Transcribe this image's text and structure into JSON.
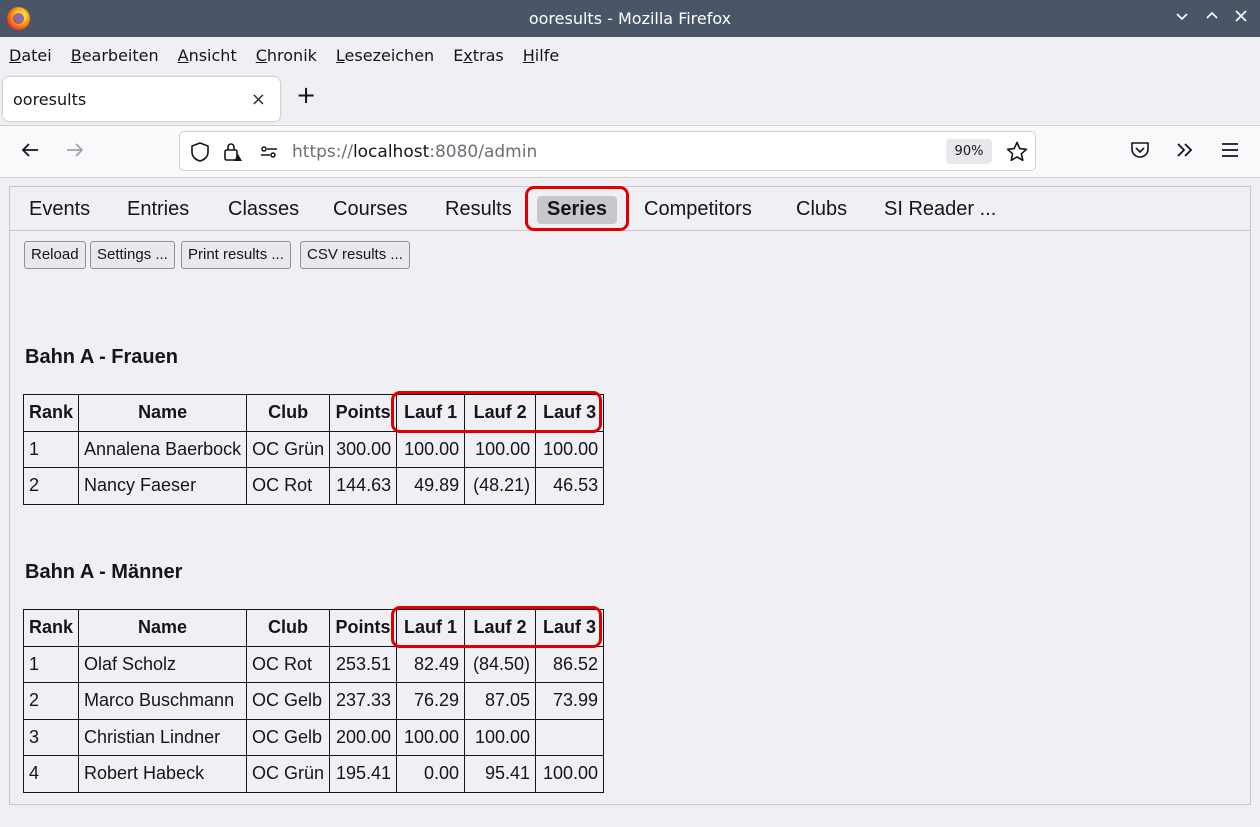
{
  "window": {
    "title": "ooresults - Mozilla Firefox"
  },
  "menu": {
    "items": [
      {
        "acc": "D",
        "rest": "atei"
      },
      {
        "acc": "B",
        "rest": "earbeiten"
      },
      {
        "acc": "A",
        "rest": "nsicht"
      },
      {
        "acc": "C",
        "rest": "hronik"
      },
      {
        "acc": "L",
        "rest": "esezeichen"
      },
      {
        "pre": "E",
        "acc": "x",
        "rest": "tras"
      },
      {
        "acc": "H",
        "rest": "ilfe"
      }
    ]
  },
  "browser_tab": {
    "label": "ooresults",
    "close": "×"
  },
  "new_tab": "+",
  "urlbar": {
    "scheme": "https://",
    "host": "localhost",
    "rest": ":8080/admin",
    "zoom": "90%"
  },
  "app_tabs": [
    "Events",
    "Entries",
    "Classes",
    "Courses",
    "Results",
    "Series",
    "Competitors",
    "Clubs",
    "SI Reader ..."
  ],
  "active_tab": "Series",
  "buttons": {
    "reload": "Reload",
    "settings": "Settings ...",
    "print": "Print results ...",
    "csv": "CSV results ..."
  },
  "columns": [
    "Rank",
    "Name",
    "Club",
    "Points",
    "Lauf 1",
    "Lauf 2",
    "Lauf 3"
  ],
  "sections": [
    {
      "title": "Bahn A - Frauen",
      "rows": [
        [
          "1",
          "Annalena Baerbock",
          "OC Grün",
          "300.00",
          "100.00",
          "100.00",
          "100.00"
        ],
        [
          "2",
          "Nancy Faeser",
          "OC Rot",
          "144.63",
          "49.89",
          "(48.21)",
          "46.53"
        ]
      ]
    },
    {
      "title": "Bahn A - Männer",
      "rows": [
        [
          "1",
          "Olaf Scholz",
          "OC Rot",
          "253.51",
          "82.49",
          "(84.50)",
          "86.52"
        ],
        [
          "2",
          "Marco Buschmann",
          "OC Gelb",
          "237.33",
          "76.29",
          "87.05",
          "73.99"
        ],
        [
          "3",
          "Christian Lindner",
          "OC Gelb",
          "200.00",
          "100.00",
          "100.00",
          ""
        ],
        [
          "4",
          "Robert Habeck",
          "OC Grün",
          "195.41",
          "0.00",
          "95.41",
          "100.00"
        ]
      ]
    }
  ],
  "colors": {
    "highlight": "#e00000",
    "titlebar": "#4a5568"
  }
}
